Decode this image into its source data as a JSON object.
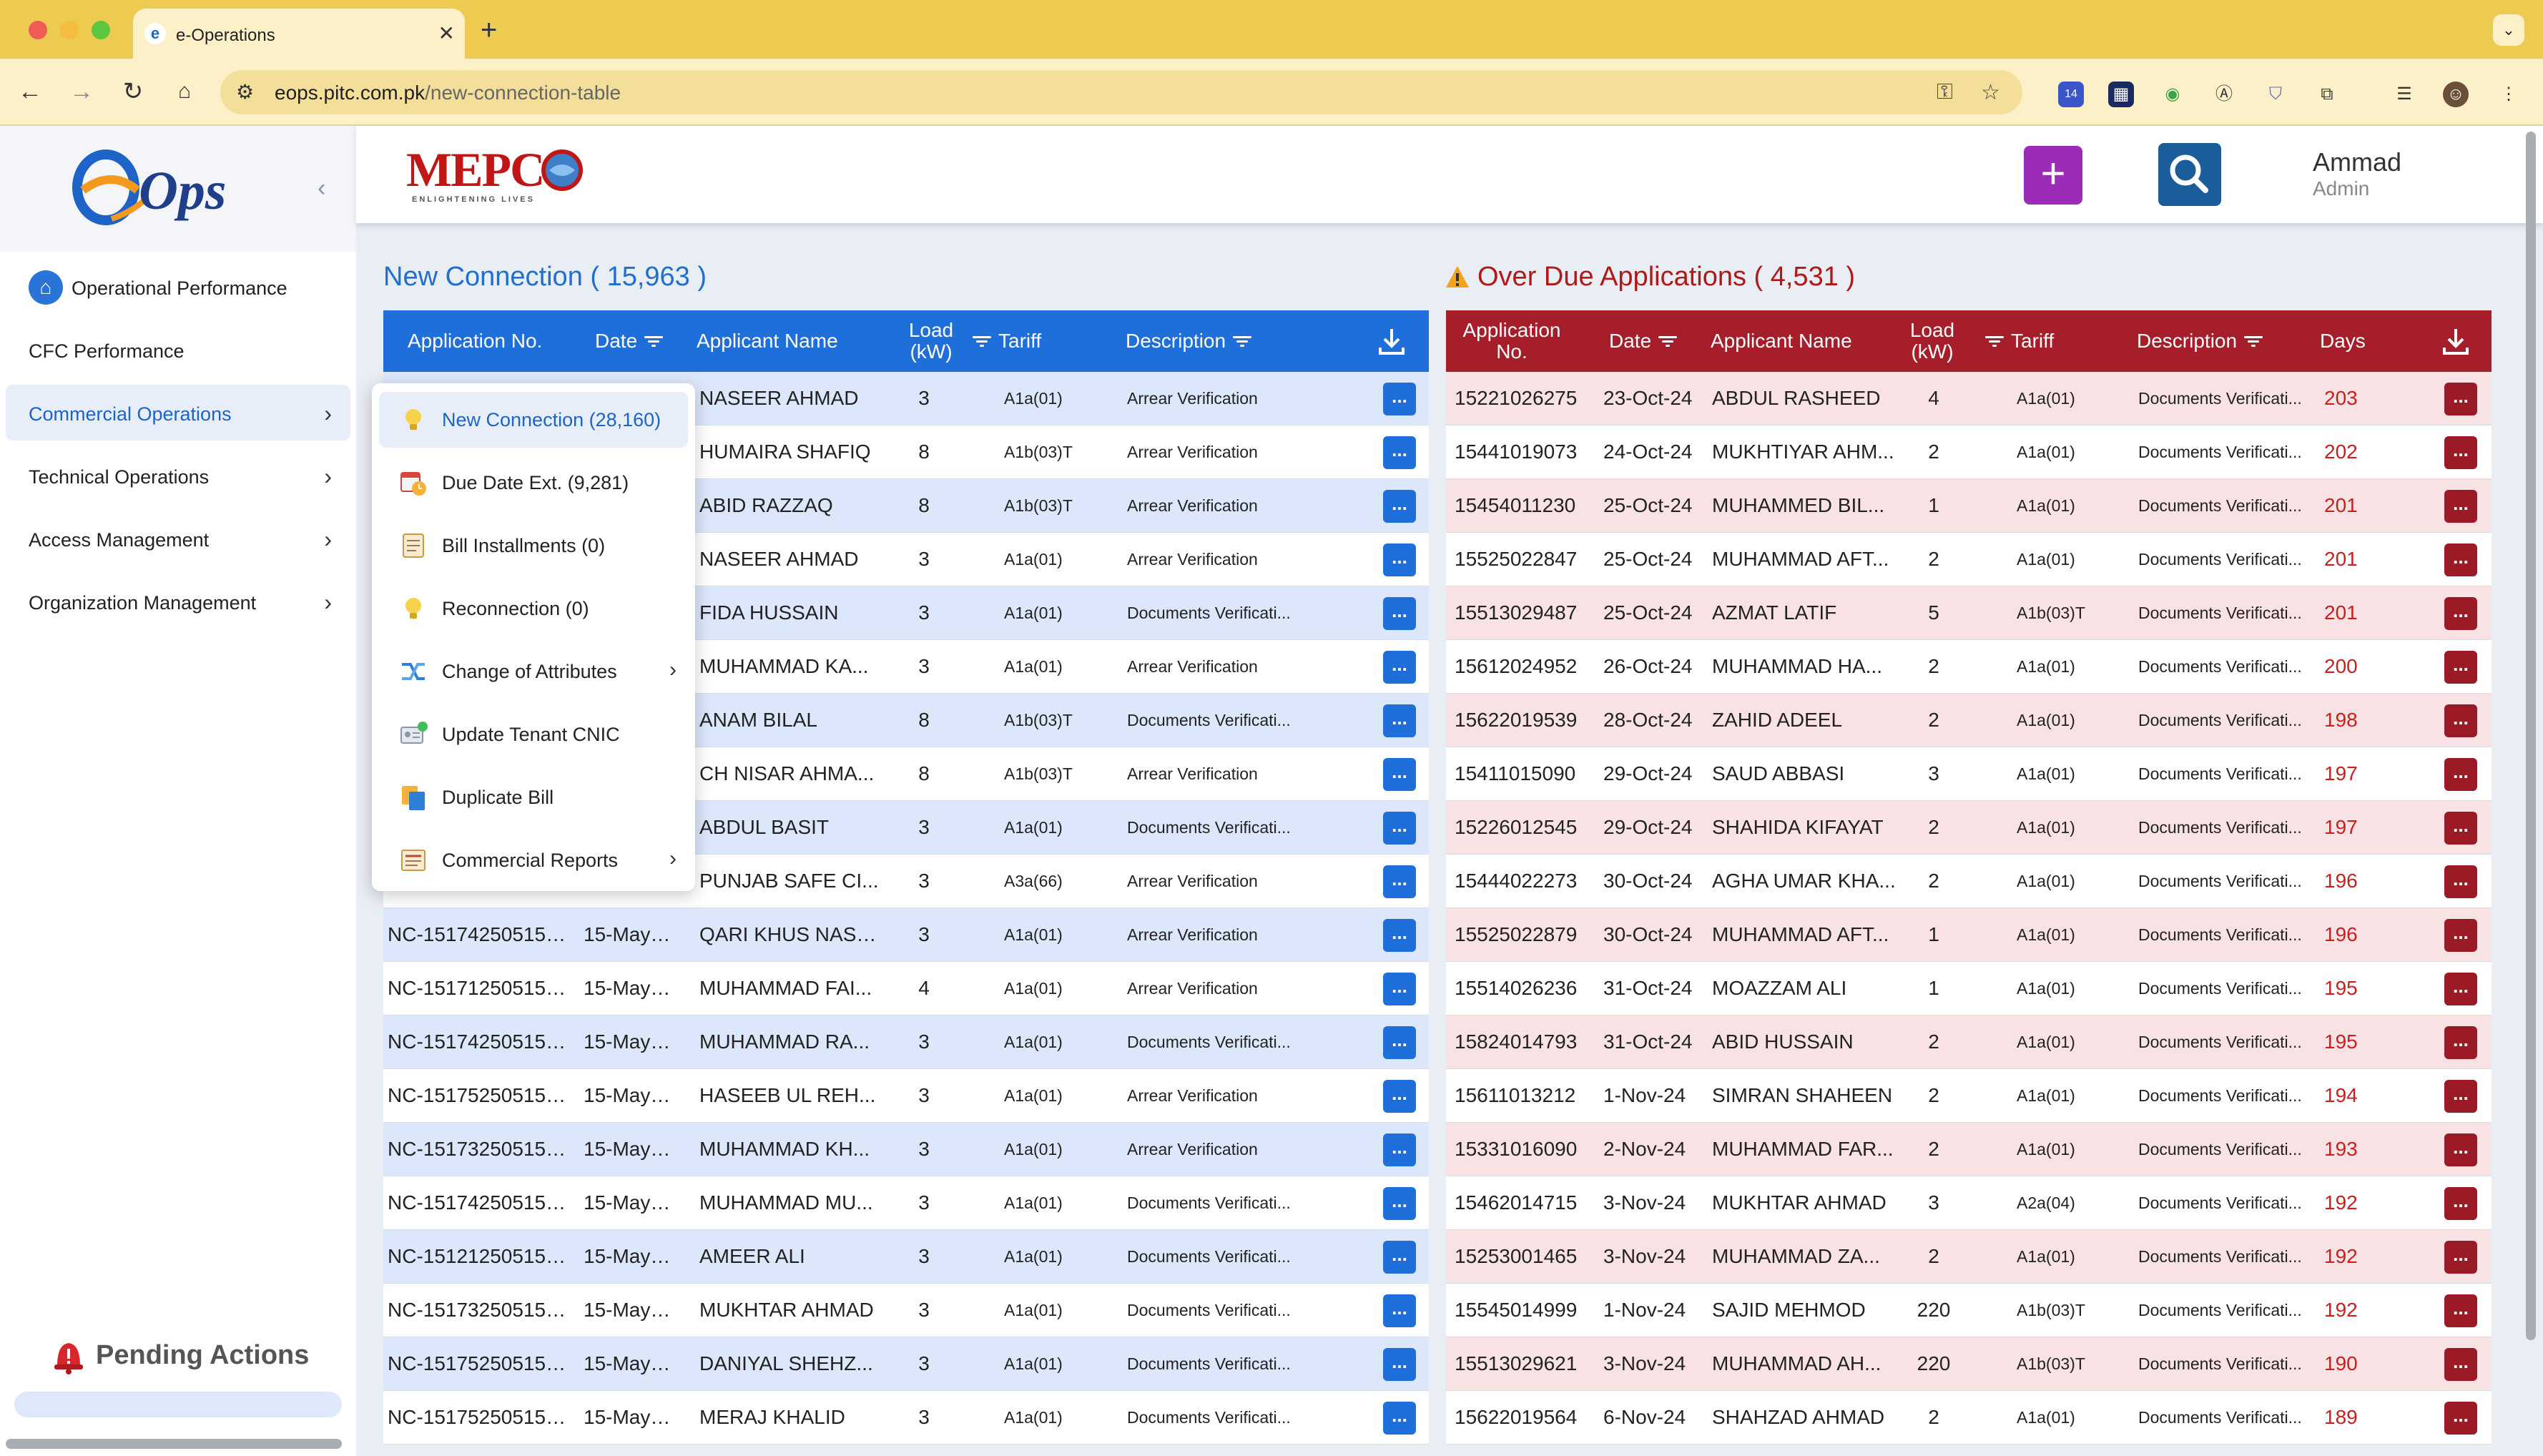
{
  "browser": {
    "tab_title": "e-Operations",
    "tab_favicon": "e",
    "url_host": "eops.pitc.com.pk",
    "url_path": "/new-connection-table",
    "extension_badge": "14"
  },
  "sidebar": {
    "items": [
      {
        "label": "Operational Performance",
        "icon": "home-icon"
      },
      {
        "label": "CFC Performance"
      },
      {
        "label": "Commercial Operations",
        "active": true
      },
      {
        "label": "Technical Operations"
      },
      {
        "label": "Access Management"
      },
      {
        "label": "Organization Management"
      }
    ],
    "pending_label": "Pending Actions"
  },
  "header": {
    "user_name": "Ammad",
    "user_role": "Admin",
    "add_label": "+"
  },
  "dropdown": {
    "items": [
      {
        "label": "New Connection (28,160)",
        "icon": "bulb-icon",
        "active": true
      },
      {
        "label": "Due Date Ext. (9,281)",
        "icon": "calendar-clock-icon"
      },
      {
        "label": "Bill Installments (0)",
        "icon": "bill-icon"
      },
      {
        "label": "Reconnection (0)",
        "icon": "bulb-icon"
      },
      {
        "label": "Change of Attributes",
        "icon": "shuffle-icon",
        "submenu": true
      },
      {
        "label": "Update Tenant CNIC",
        "icon": "id-card-icon"
      },
      {
        "label": "Duplicate Bill",
        "icon": "copy-icon"
      },
      {
        "label": "Commercial Reports",
        "icon": "report-icon",
        "submenu": true
      }
    ]
  },
  "new_connection": {
    "title": "New Connection ( 15,963 )",
    "headers": {
      "app_no": "Application No.",
      "date": "Date",
      "name": "Applicant Name",
      "load_1": "Load",
      "load_2": "(kW)",
      "tariff": "Tariff",
      "description": "Description"
    },
    "action_label": "...",
    "rows": [
      {
        "app_no": "",
        "date": "",
        "name": "NASEER AHMAD",
        "load": "3",
        "tariff": "A1a(01)",
        "desc": "Arrear Verification"
      },
      {
        "app_no": "",
        "date": "",
        "name": "HUMAIRA SHAFIQ",
        "load": "8",
        "tariff": "A1b(03)T",
        "desc": "Arrear Verification"
      },
      {
        "app_no": "",
        "date": "",
        "name": "ABID RAZZAQ",
        "load": "8",
        "tariff": "A1b(03)T",
        "desc": "Arrear Verification"
      },
      {
        "app_no": "",
        "date": "",
        "name": "NASEER AHMAD",
        "load": "3",
        "tariff": "A1a(01)",
        "desc": "Arrear Verification"
      },
      {
        "app_no": "",
        "date": "",
        "name": "FIDA HUSSAIN",
        "load": "3",
        "tariff": "A1a(01)",
        "desc": "Documents Verificati..."
      },
      {
        "app_no": "",
        "date": "",
        "name": "MUHAMMAD KA...",
        "load": "3",
        "tariff": "A1a(01)",
        "desc": "Arrear Verification"
      },
      {
        "app_no": "",
        "date": "",
        "name": "ANAM BILAL",
        "load": "8",
        "tariff": "A1b(03)T",
        "desc": "Documents Verificati..."
      },
      {
        "app_no": "",
        "date": "",
        "name": "CH NISAR AHMA...",
        "load": "8",
        "tariff": "A1b(03)T",
        "desc": "Arrear Verification"
      },
      {
        "app_no": "",
        "date": "",
        "name": "ABDUL BASIT",
        "load": "3",
        "tariff": "A1a(01)",
        "desc": "Documents Verificati..."
      },
      {
        "app_no": "",
        "date": "",
        "name": "PUNJAB SAFE CI...",
        "load": "3",
        "tariff": "A3a(66)",
        "desc": "Arrear Verification"
      },
      {
        "app_no": "NC-151742505150...",
        "date": "15-May-25",
        "name": "QARI KHUS NASE...",
        "load": "3",
        "tariff": "A1a(01)",
        "desc": "Arrear Verification"
      },
      {
        "app_no": "NC-151712505150...",
        "date": "15-May-25",
        "name": "MUHAMMAD FAI...",
        "load": "4",
        "tariff": "A1a(01)",
        "desc": "Arrear Verification"
      },
      {
        "app_no": "NC-151742505150...",
        "date": "15-May-25",
        "name": "MUHAMMAD RA...",
        "load": "3",
        "tariff": "A1a(01)",
        "desc": "Documents Verificati..."
      },
      {
        "app_no": "NC-151752505150...",
        "date": "15-May-25",
        "name": "HASEEB UL REH...",
        "load": "3",
        "tariff": "A1a(01)",
        "desc": "Arrear Verification"
      },
      {
        "app_no": "NC-151732505150...",
        "date": "15-May-25",
        "name": "MUHAMMAD KH...",
        "load": "3",
        "tariff": "A1a(01)",
        "desc": "Arrear Verification"
      },
      {
        "app_no": "NC-151742505150...",
        "date": "15-May-25",
        "name": "MUHAMMAD MU...",
        "load": "3",
        "tariff": "A1a(01)",
        "desc": "Documents Verificati..."
      },
      {
        "app_no": "NC-151212505150...",
        "date": "15-May-25",
        "name": "AMEER ALI",
        "load": "3",
        "tariff": "A1a(01)",
        "desc": "Documents Verificati..."
      },
      {
        "app_no": "NC-151732505150...",
        "date": "15-May-25",
        "name": "MUKHTAR AHMAD",
        "load": "3",
        "tariff": "A1a(01)",
        "desc": "Documents Verificati..."
      },
      {
        "app_no": "NC-151752505150...",
        "date": "15-May-25",
        "name": "DANIYAL SHEHZ...",
        "load": "3",
        "tariff": "A1a(01)",
        "desc": "Documents Verificati..."
      },
      {
        "app_no": "NC-151752505150...",
        "date": "15-May-25",
        "name": "MERAJ KHALID",
        "load": "3",
        "tariff": "A1a(01)",
        "desc": "Documents Verificati..."
      }
    ]
  },
  "overdue": {
    "title": "Over Due Applications ( 4,531 )",
    "headers": {
      "app_no_1": "Application",
      "app_no_2": "No.",
      "date": "Date",
      "name": "Applicant Name",
      "load_1": "Load",
      "load_2": "(kW)",
      "tariff": "Tariff",
      "description": "Description",
      "days": "Days"
    },
    "action_label": "...",
    "rows": [
      {
        "app_no": "15221026275",
        "date": "23-Oct-24",
        "name": "ABDUL RASHEED",
        "load": "4",
        "tariff": "A1a(01)",
        "desc": "Documents Verificati...",
        "days": "203"
      },
      {
        "app_no": "15441019073",
        "date": "24-Oct-24",
        "name": "MUKHTIYAR AHM...",
        "load": "2",
        "tariff": "A1a(01)",
        "desc": "Documents Verificati...",
        "days": "202"
      },
      {
        "app_no": "15454011230",
        "date": "25-Oct-24",
        "name": "MUHAMMED BIL...",
        "load": "1",
        "tariff": "A1a(01)",
        "desc": "Documents Verificati...",
        "days": "201"
      },
      {
        "app_no": "15525022847",
        "date": "25-Oct-24",
        "name": "MUHAMMAD AFT...",
        "load": "2",
        "tariff": "A1a(01)",
        "desc": "Documents Verificati...",
        "days": "201"
      },
      {
        "app_no": "15513029487",
        "date": "25-Oct-24",
        "name": "AZMAT LATIF",
        "load": "5",
        "tariff": "A1b(03)T",
        "desc": "Documents Verificati...",
        "days": "201"
      },
      {
        "app_no": "15612024952",
        "date": "26-Oct-24",
        "name": "MUHAMMAD HA...",
        "load": "2",
        "tariff": "A1a(01)",
        "desc": "Documents Verificati...",
        "days": "200"
      },
      {
        "app_no": "15622019539",
        "date": "28-Oct-24",
        "name": "ZAHID ADEEL",
        "load": "2",
        "tariff": "A1a(01)",
        "desc": "Documents Verificati...",
        "days": "198"
      },
      {
        "app_no": "15411015090",
        "date": "29-Oct-24",
        "name": "SAUD ABBASI",
        "load": "3",
        "tariff": "A1a(01)",
        "desc": "Documents Verificati...",
        "days": "197"
      },
      {
        "app_no": "15226012545",
        "date": "29-Oct-24",
        "name": "SHAHIDA KIFAYAT",
        "load": "2",
        "tariff": "A1a(01)",
        "desc": "Documents Verificati...",
        "days": "197"
      },
      {
        "app_no": "15444022273",
        "date": "30-Oct-24",
        "name": "AGHA UMAR KHA...",
        "load": "2",
        "tariff": "A1a(01)",
        "desc": "Documents Verificati...",
        "days": "196"
      },
      {
        "app_no": "15525022879",
        "date": "30-Oct-24",
        "name": "MUHAMMAD AFT...",
        "load": "1",
        "tariff": "A1a(01)",
        "desc": "Documents Verificati...",
        "days": "196"
      },
      {
        "app_no": "15514026236",
        "date": "31-Oct-24",
        "name": "MOAZZAM ALI",
        "load": "1",
        "tariff": "A1a(01)",
        "desc": "Documents Verificati...",
        "days": "195"
      },
      {
        "app_no": "15824014793",
        "date": "31-Oct-24",
        "name": "ABID HUSSAIN",
        "load": "2",
        "tariff": "A1a(01)",
        "desc": "Documents Verificati...",
        "days": "195"
      },
      {
        "app_no": "15611013212",
        "date": "1-Nov-24",
        "name": "SIMRAN SHAHEEN",
        "load": "2",
        "tariff": "A1a(01)",
        "desc": "Documents Verificati...",
        "days": "194"
      },
      {
        "app_no": "15331016090",
        "date": "2-Nov-24",
        "name": "MUHAMMAD FAR...",
        "load": "2",
        "tariff": "A1a(01)",
        "desc": "Documents Verificati...",
        "days": "193"
      },
      {
        "app_no": "15462014715",
        "date": "3-Nov-24",
        "name": "MUKHTAR AHMAD",
        "load": "3",
        "tariff": "A2a(04)",
        "desc": "Documents Verificati...",
        "days": "192"
      },
      {
        "app_no": "15253001465",
        "date": "3-Nov-24",
        "name": "MUHAMMAD ZA...",
        "load": "2",
        "tariff": "A1a(01)",
        "desc": "Documents Verificati...",
        "days": "192"
      },
      {
        "app_no": "15545014999",
        "date": "1-Nov-24",
        "name": "SAJID MEHMOD",
        "load": "220",
        "tariff": "A1b(03)T",
        "desc": "Documents Verificati...",
        "days": "192"
      },
      {
        "app_no": "15513029621",
        "date": "3-Nov-24",
        "name": "MUHAMMAD AH...",
        "load": "220",
        "tariff": "A1b(03)T",
        "desc": "Documents Verificati...",
        "days": "190"
      },
      {
        "app_no": "15622019564",
        "date": "6-Nov-24",
        "name": "SHAHZAD AHMAD",
        "load": "2",
        "tariff": "A1a(01)",
        "desc": "Documents Verificati...",
        "days": "189"
      }
    ]
  },
  "colors": {
    "left_header": "#1e6fd9",
    "right_header": "#a51e2a",
    "days": "#c81f1f",
    "accent": "#1b64c8"
  }
}
